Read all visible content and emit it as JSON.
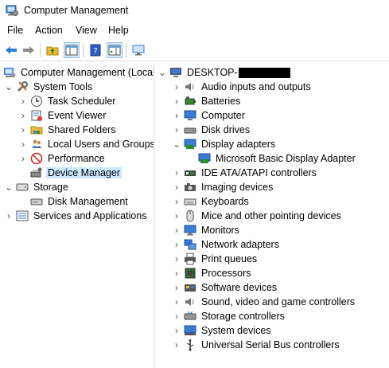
{
  "window": {
    "title": "Computer Management"
  },
  "menu": [
    "File",
    "Action",
    "View",
    "Help"
  ],
  "toolbar": [
    "back-arrow-icon",
    "forward-arrow-icon",
    "up-folder-icon",
    "show-hide-tree-icon",
    "help-icon",
    "action-pane-icon",
    "monitor-icon"
  ],
  "left_tree": {
    "root": "Computer Management (Local",
    "system_tools": "System Tools",
    "task_scheduler": "Task Scheduler",
    "event_viewer": "Event Viewer",
    "shared_folders": "Shared Folders",
    "local_users": "Local Users and Groups",
    "performance": "Performance",
    "device_manager": "Device Manager",
    "storage": "Storage",
    "disk_management": "Disk Management",
    "services": "Services and Applications"
  },
  "device_tree": {
    "root": "DESKTOP-",
    "categories": {
      "audio": "Audio inputs and outputs",
      "batteries": "Batteries",
      "computer": "Computer",
      "disk_drives": "Disk drives",
      "display_adapters": "Display adapters",
      "display_child": "Microsoft Basic Display Adapter",
      "ide": "IDE ATA/ATAPI controllers",
      "imaging": "Imaging devices",
      "keyboards": "Keyboards",
      "mice": "Mice and other pointing devices",
      "monitors": "Monitors",
      "network": "Network adapters",
      "print": "Print queues",
      "processors": "Processors",
      "software": "Software devices",
      "sound": "Sound, video and game controllers",
      "storage_ctrl": "Storage controllers",
      "system": "System devices",
      "usb": "Universal Serial Bus controllers"
    }
  }
}
